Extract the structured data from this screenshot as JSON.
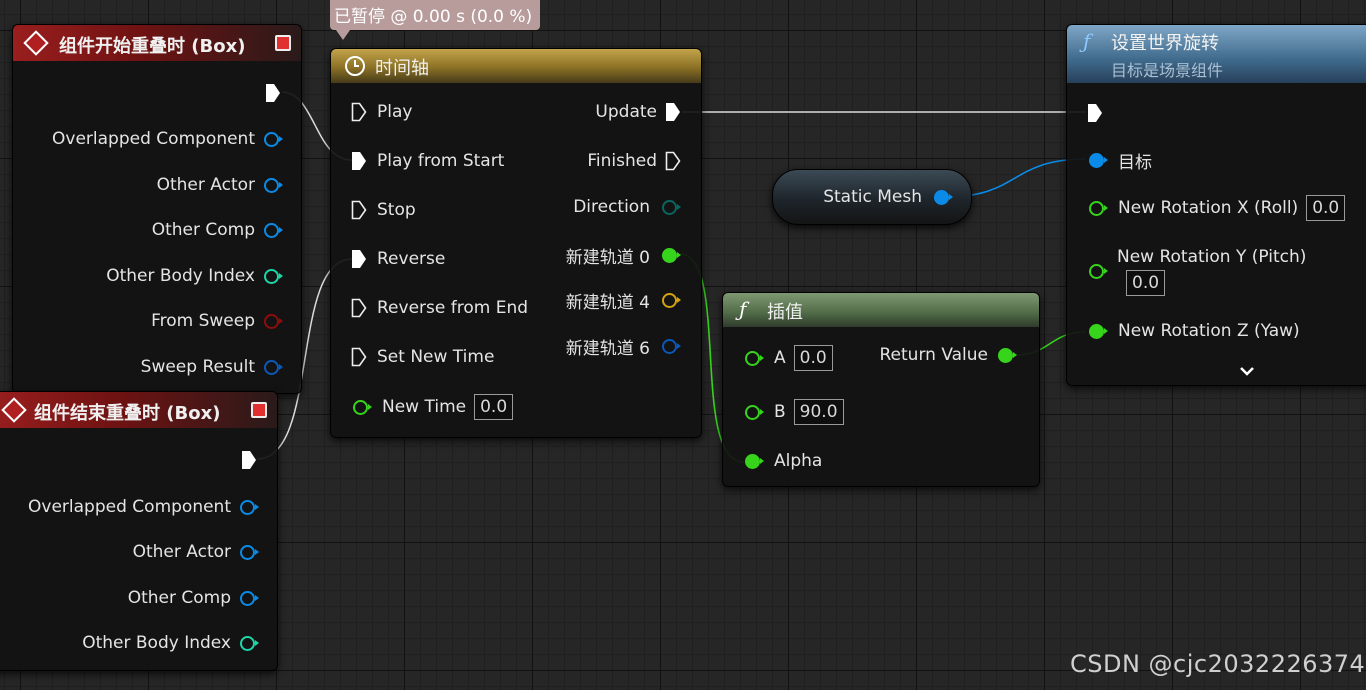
{
  "tooltip": {
    "text": "已暂停 @ 0.00 s (0.0 %)"
  },
  "begin_overlap": {
    "title": "组件开始重叠时 (Box)",
    "pins": [
      "Overlapped Component",
      "Other Actor",
      "Other Comp",
      "Other Body Index",
      "From Sweep",
      "Sweep Result"
    ]
  },
  "end_overlap": {
    "title": "组件结束重叠时 (Box)",
    "pins": [
      "Overlapped Component",
      "Other Actor",
      "Other Comp",
      "Other Body Index"
    ]
  },
  "timeline": {
    "title": "时间轴",
    "inputs": [
      "Play",
      "Play from Start",
      "Stop",
      "Reverse",
      "Reverse from End",
      "Set New Time"
    ],
    "new_time_label": "New Time",
    "new_time_value": "0.0",
    "outputs": [
      "Update",
      "Finished",
      "Direction",
      "新建轨道 0",
      "新建轨道 4",
      "新建轨道 6"
    ]
  },
  "static_mesh": {
    "label": "Static Mesh"
  },
  "lerp": {
    "title": "插值",
    "a_label": "A",
    "a_value": "0.0",
    "b_label": "B",
    "b_value": "90.0",
    "alpha_label": "Alpha",
    "return_label": "Return Value"
  },
  "set_rotation": {
    "title": "设置世界旋转",
    "subtitle": "目标是场景组件",
    "target_label": "目标",
    "x_label": "New Rotation X (Roll)",
    "x_value": "0.0",
    "y_label": "New Rotation Y (Pitch)",
    "y_value": "0.0",
    "z_label": "New Rotation Z (Yaw)"
  },
  "watermark": "CSDN @cjc2032226374",
  "colors": {
    "object_pin": "#0a8be8",
    "int_pin": "#1ed6a6",
    "bool_pin": "#8e0c0c",
    "struct_pin": "#0a58b8",
    "float_pin": "#37d41c",
    "byte_pin": "#0a6560",
    "wildcard_pin": "#d4a20c"
  }
}
